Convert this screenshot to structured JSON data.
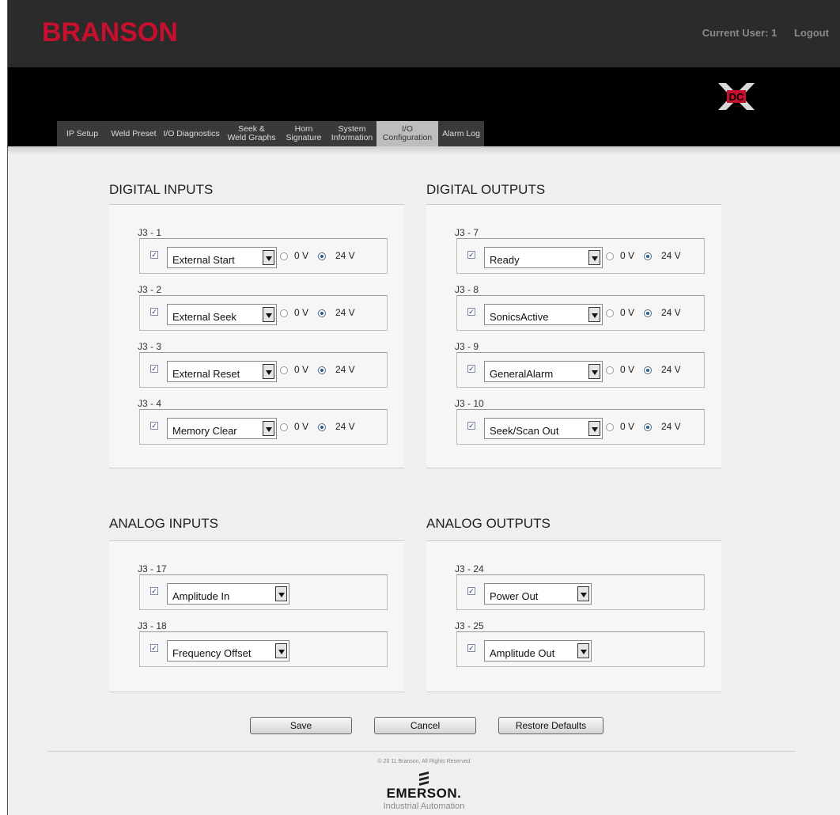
{
  "header": {
    "brand": "BRANSON",
    "current_user": "Current User: 1",
    "logout": "Logout"
  },
  "tabs": [
    {
      "label": "IP Setup"
    },
    {
      "label": "Weld Preset"
    },
    {
      "label": "I/O Diagnostics"
    },
    {
      "label": "Seek &\nWeld Graphs"
    },
    {
      "label": "Horn\nSignature"
    },
    {
      "label": "System\nInformation"
    },
    {
      "label": "I/O\nConfiguration",
      "active": true
    },
    {
      "label": "Alarm Log"
    }
  ],
  "digital_inputs": {
    "title": "DIGITAL INPUTS",
    "rows": [
      {
        "pin": "J3 - 1",
        "value": "External Start",
        "checked": true,
        "low": "0 V",
        "high": "24 V",
        "selected": "24 V"
      },
      {
        "pin": "J3 - 2",
        "value": "External Seek",
        "checked": true,
        "low": "0 V",
        "high": "24 V",
        "selected": "24 V"
      },
      {
        "pin": "J3 - 3",
        "value": "External Reset",
        "checked": true,
        "low": "0 V",
        "high": "24 V",
        "selected": "24 V"
      },
      {
        "pin": "J3 - 4",
        "value": "Memory Clear",
        "checked": true,
        "low": "0 V",
        "high": "24 V",
        "selected": "24 V"
      }
    ]
  },
  "digital_outputs": {
    "title": "DIGITAL OUTPUTS",
    "rows": [
      {
        "pin": "J3 - 7",
        "value": "Ready",
        "checked": true,
        "low": "0 V",
        "high": "24 V",
        "selected": "24 V"
      },
      {
        "pin": "J3 - 8",
        "value": "SonicsActive",
        "checked": true,
        "low": "0 V",
        "high": "24 V",
        "selected": "24 V"
      },
      {
        "pin": "J3 - 9",
        "value": "GeneralAlarm",
        "checked": true,
        "low": "0 V",
        "high": "24 V",
        "selected": "24 V"
      },
      {
        "pin": "J3 - 10",
        "value": "Seek/Scan Out",
        "checked": true,
        "low": "0 V",
        "high": "24 V",
        "selected": "24 V"
      }
    ]
  },
  "analog_inputs": {
    "title": "ANALOG INPUTS",
    "rows": [
      {
        "pin": "J3 - 17",
        "value": "Amplitude In",
        "checked": true
      },
      {
        "pin": "J3 - 18",
        "value": "Frequency Offset",
        "checked": true
      }
    ]
  },
  "analog_outputs": {
    "title": "ANALOG OUTPUTS",
    "rows": [
      {
        "pin": "J3 - 24",
        "value": "Power Out",
        "checked": true
      },
      {
        "pin": "J3 - 25",
        "value": "Amplitude Out",
        "checked": true
      }
    ]
  },
  "buttons": {
    "save": "Save",
    "cancel": "Cancel",
    "restore": "Restore Defaults"
  },
  "footer": {
    "copyright": "© 20 11 Branson, All Rights Reserved",
    "company": "EMERSON.",
    "division": "Industrial Automation"
  },
  "colors": {
    "brand_red": "#c8102e",
    "active_tab": "#bdbdbd",
    "radio_selected": "#2a5b8a"
  }
}
